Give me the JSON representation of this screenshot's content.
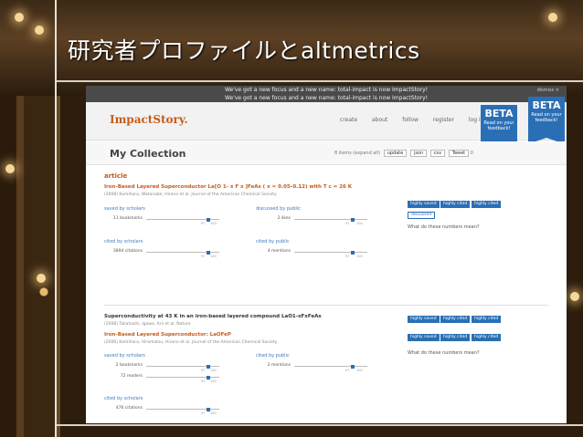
{
  "slide": {
    "title": "研究者プロファイルとaltmetrics"
  },
  "banner": {
    "line1": "We've got a new focus and a new name: total-impact is now ImpactStory!",
    "line2": "We've got a new focus and a new name: total-impact is now ImpactStory!",
    "dismiss": "dismiss ×"
  },
  "nav": {
    "logo": "ImpactStory.",
    "links": [
      "create",
      "about",
      "follow",
      "register",
      "log in"
    ],
    "beta": "BETA",
    "beta_sub": "Read on your feedback!"
  },
  "collection": {
    "title": "My Collection",
    "count": "8 items (expand all)",
    "buttons": [
      "update",
      "json",
      "csv",
      "Tweet"
    ],
    "tweet_count": "0"
  },
  "section": "article",
  "item1": {
    "title": "Iron-Based Layered Superconductor La[O 1- x F x ]FeAs ( x = 0.05–0.12) with T c = 26 K",
    "meta": "(2008) Kamihara, Watanabe, Hirano et al. Journal of the American Chemical Society",
    "saved_label": "saved by scholars",
    "saved_val": "11 bookmarks",
    "discussed_label": "discussed by public",
    "discussed_val": "2 likes",
    "cited_s_label": "cited by scholars",
    "cited_s_val": "3894 citations",
    "cited_p_label": "cited by public",
    "cited_p_val": "4 mentions",
    "badges": [
      "highly saved",
      "highly cited",
      "highly cited"
    ],
    "badge_light": "discussed"
  },
  "item2": {
    "title_alt": "Superconductivity at 43 K in an iron-based layered compound LaO1-xFxFeAs",
    "meta_alt": "(2008) Takahashi, Igawa, Arii et al. Nature",
    "title": "Iron-Based Layered Superconductor: LaOFeP",
    "meta": "(2006) Kamihara, Hiramatsu, Hirano et al. Journal of the American Chemical Society",
    "saved_label": "saved by scholars",
    "saved_val1": "2 bookmarks",
    "saved_val2": "72 readers",
    "cited_p_label": "cited by public",
    "cited_p_val": "2 mentions",
    "cited_s_label": "cited by scholars",
    "cited_s_val": "476 citations",
    "badges": [
      "highly saved",
      "highly cited",
      "highly cited"
    ]
  },
  "help": "What do these numbers mean?",
  "ticks": {
    "a": "97",
    "b": "100"
  },
  "colors": {
    "accent": "#c55b1a",
    "blue": "#2a6fb5"
  }
}
